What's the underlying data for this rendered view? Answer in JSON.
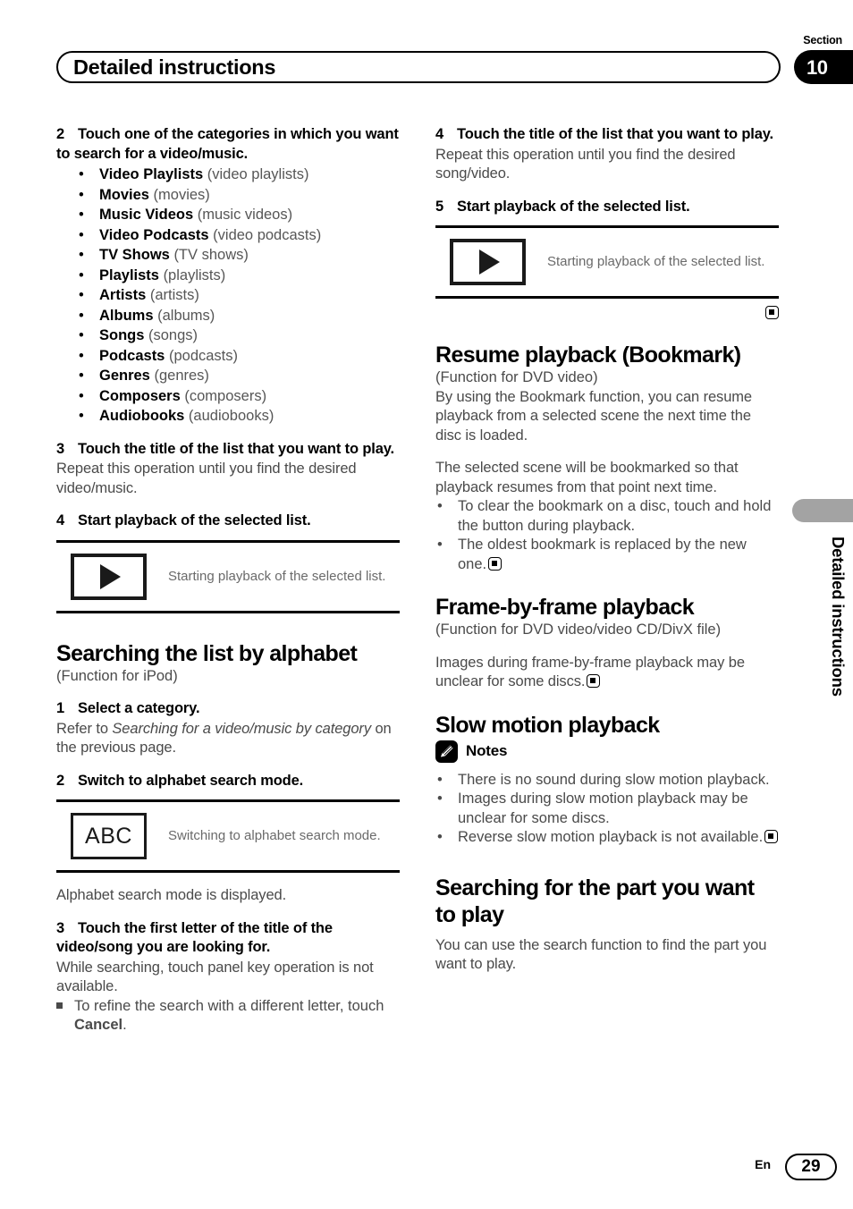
{
  "header": {
    "title": "Detailed instructions",
    "section_label": "Section",
    "section_number": "10"
  },
  "edge_tab": {
    "label": "Detailed instructions"
  },
  "footer": {
    "language": "En",
    "page_number": "29"
  },
  "left_column": {
    "step2": {
      "number": "2",
      "text": "Touch one of the categories in which you want to search for a video/music."
    },
    "categories": [
      {
        "term": "Video Playlists",
        "paren": "(video playlists)"
      },
      {
        "term": "Movies",
        "paren": "(movies)"
      },
      {
        "term": "Music Videos",
        "paren": "(music videos)"
      },
      {
        "term": "Video Podcasts",
        "paren": "(video podcasts)"
      },
      {
        "term": "TV Shows",
        "paren": "(TV shows)"
      },
      {
        "term": "Playlists",
        "paren": "(playlists)"
      },
      {
        "term": "Artists",
        "paren": "(artists)"
      },
      {
        "term": "Albums",
        "paren": "(albums)"
      },
      {
        "term": "Songs",
        "paren": "(songs)"
      },
      {
        "term": "Podcasts",
        "paren": "(podcasts)"
      },
      {
        "term": "Genres",
        "paren": "(genres)"
      },
      {
        "term": "Composers",
        "paren": "(composers)"
      },
      {
        "term": "Audiobooks",
        "paren": "(audiobooks)"
      }
    ],
    "step3": {
      "number": "3",
      "text": "Touch the title of the list that you want to play.",
      "body": "Repeat this operation until you find the desired video/music."
    },
    "step4": {
      "number": "4",
      "text": "Start playback of the selected list."
    },
    "figure_play": {
      "icon": "play-icon",
      "caption": "Starting playback of the selected list."
    },
    "alphabet_section": {
      "heading": "Searching the list by alphabet",
      "function_note": "(Function for iPod)",
      "step1": {
        "number": "1",
        "text": "Select a category.",
        "body_prefix": "Refer to ",
        "body_italic": "Searching for a video/music by category",
        "body_suffix": " on the previous page."
      },
      "step2": {
        "number": "2",
        "text": "Switch to alphabet search mode."
      },
      "figure_abc": {
        "icon": "abc-icon",
        "icon_text": "ABC",
        "caption": "Switching to alphabet search mode."
      },
      "after_figure": "Alphabet search mode is displayed.",
      "step3": {
        "number": "3",
        "text": "Touch the first letter of the title of the video/song you are looking for.",
        "body": "While searching, touch panel key operation is not available.",
        "sub_bullet_prefix": "To refine the search with a different letter, touch ",
        "sub_bullet_bold": "Cancel",
        "sub_bullet_suffix": "."
      }
    }
  },
  "right_column": {
    "step4": {
      "number": "4",
      "text": "Touch the title of the list that you want to play.",
      "body": "Repeat this operation until you find the desired song/video."
    },
    "step5": {
      "number": "5",
      "text": "Start playback of the selected list."
    },
    "figure_play": {
      "icon": "play-icon",
      "caption": "Starting playback of the selected list."
    },
    "resume_section": {
      "heading": "Resume playback (Bookmark)",
      "function_note": "(Function for DVD video)",
      "intro": "By using the Bookmark function, you can resume playback from a selected scene the next time the disc is loaded.",
      "body": "The selected scene will be bookmarked so that playback resumes from that point next time.",
      "bullets": [
        "To clear the bookmark on a disc, touch and hold the button during playback.",
        "The oldest bookmark is replaced by the new one."
      ]
    },
    "frame_section": {
      "heading": "Frame-by-frame playback",
      "function_note": "(Function for DVD video/video CD/DivX file)",
      "body": "Images during frame-by-frame playback may be unclear for some discs."
    },
    "slow_section": {
      "heading": "Slow motion playback",
      "notes_label": "Notes",
      "notes": [
        "There is no sound during slow motion playback.",
        "Images during slow motion playback may be unclear for some discs.",
        "Reverse slow motion playback is not available."
      ]
    },
    "search_section": {
      "heading": "Searching for the part you want to play",
      "body": "You can use the search function to find the part you want to play."
    }
  }
}
